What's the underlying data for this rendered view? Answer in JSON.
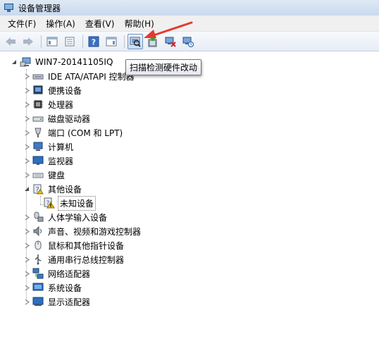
{
  "window": {
    "title": "设备管理器"
  },
  "menu": [
    {
      "label": "文件(F)"
    },
    {
      "label": "操作(A)"
    },
    {
      "label": "查看(V)"
    },
    {
      "label": "帮助(H)"
    }
  ],
  "toolbar": {
    "buttons": [
      {
        "icon": "back-arrow-icon"
      },
      {
        "icon": "forward-arrow-icon"
      },
      {
        "icon": "show-hide-console-tree-icon"
      },
      {
        "icon": "properties-icon"
      },
      {
        "icon": "help-icon"
      },
      {
        "icon": "show-action-pane-icon"
      },
      {
        "icon": "scan-hardware-icon"
      },
      {
        "icon": "update-driver-icon"
      },
      {
        "icon": "disable-device-icon"
      },
      {
        "icon": "uninstall-device-icon"
      }
    ],
    "tooltip": "扫描检测硬件改动"
  },
  "annotation_color": "#e33b2e",
  "tree": {
    "root": "WIN7-20141105IQ",
    "categories": [
      {
        "label": "IDE ATA/ATAPI 控制器",
        "icon": "ide-controller-icon"
      },
      {
        "label": "便携设备",
        "icon": "portable-device-icon"
      },
      {
        "label": "处理器",
        "icon": "processor-icon"
      },
      {
        "label": "磁盘驱动器",
        "icon": "disk-drive-icon"
      },
      {
        "label": "端口 (COM 和 LPT)",
        "icon": "port-icon"
      },
      {
        "label": "计算机",
        "icon": "computer-icon"
      },
      {
        "label": "监视器",
        "icon": "monitor-icon"
      },
      {
        "label": "键盘",
        "icon": "keyboard-icon"
      },
      {
        "label": "其他设备",
        "icon": "other-devices-icon",
        "expanded": true
      },
      {
        "label": "人体学输入设备",
        "icon": "hid-icon"
      },
      {
        "label": "声音、视频和游戏控制器",
        "icon": "sound-icon"
      },
      {
        "label": "鼠标和其他指针设备",
        "icon": "mouse-icon"
      },
      {
        "label": "通用串行总线控制器",
        "icon": "usb-icon"
      },
      {
        "label": "网络适配器",
        "icon": "network-adapter-icon"
      },
      {
        "label": "系统设备",
        "icon": "system-device-icon"
      },
      {
        "label": "显示适配器",
        "icon": "display-adapter-icon"
      }
    ],
    "unknown_device": {
      "label": "未知设备",
      "icon": "unknown-device-warning-icon"
    }
  }
}
